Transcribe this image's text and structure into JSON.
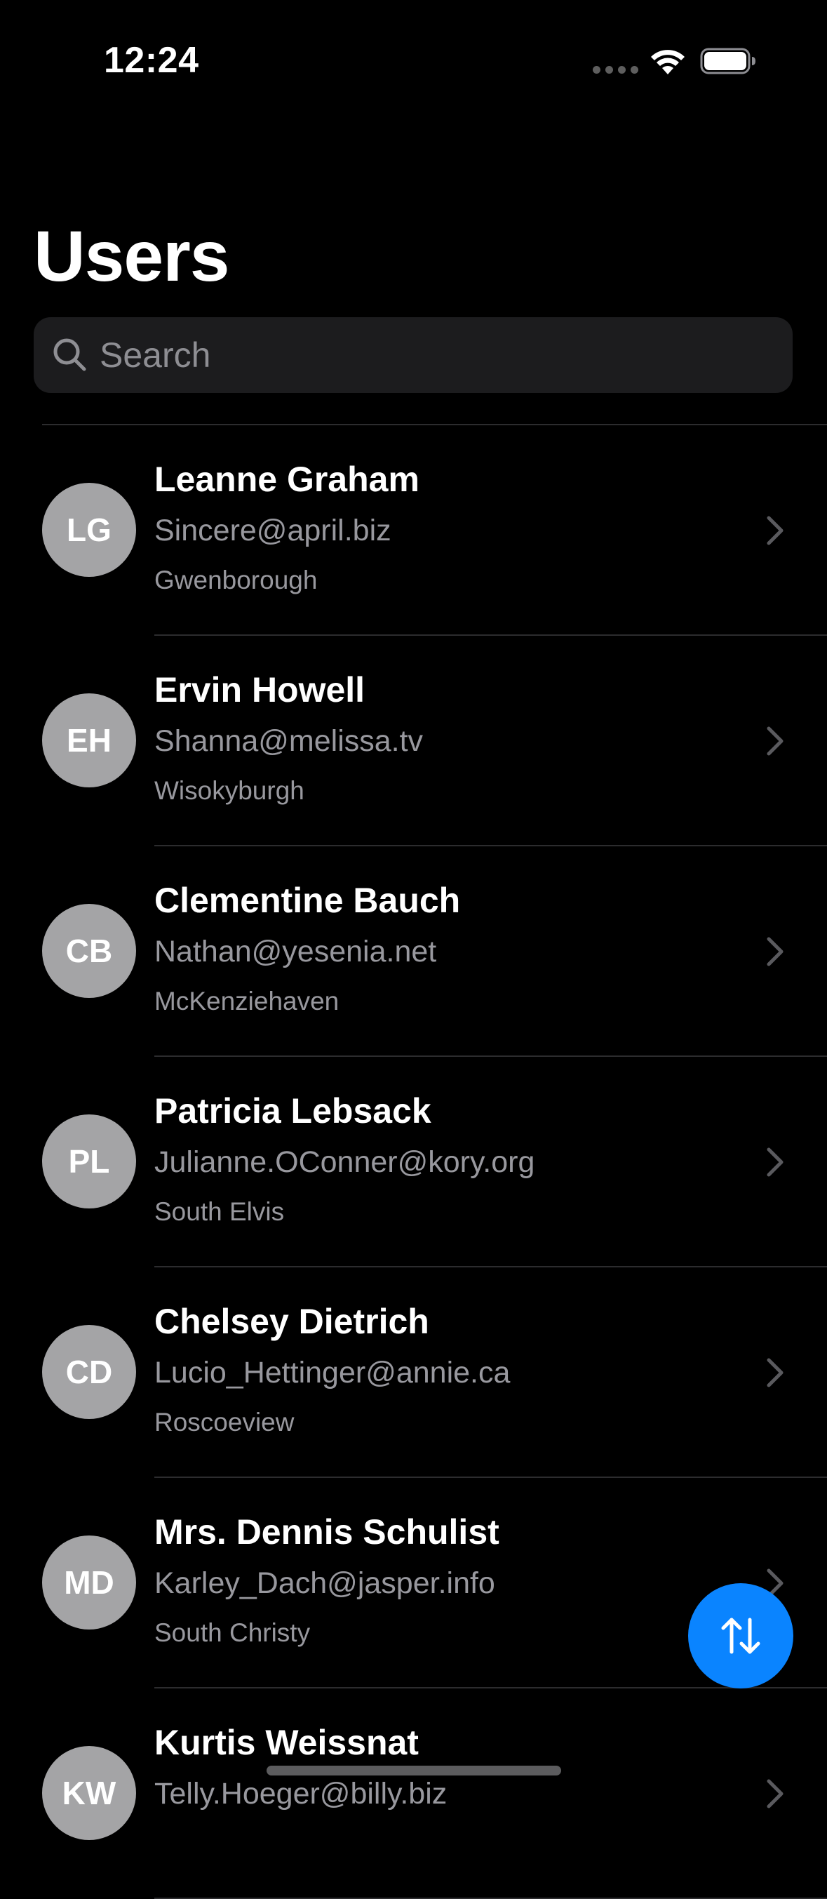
{
  "status_bar": {
    "time": "12:24"
  },
  "page": {
    "title": "Users"
  },
  "search": {
    "placeholder": "Search",
    "value": ""
  },
  "users": [
    {
      "initials": "LG",
      "name": "Leanne Graham",
      "email": "Sincere@april.biz",
      "city": "Gwenborough"
    },
    {
      "initials": "EH",
      "name": "Ervin Howell",
      "email": "Shanna@melissa.tv",
      "city": "Wisokyburgh"
    },
    {
      "initials": "CB",
      "name": "Clementine Bauch",
      "email": "Nathan@yesenia.net",
      "city": "McKenziehaven"
    },
    {
      "initials": "PL",
      "name": "Patricia Lebsack",
      "email": "Julianne.OConner@kory.org",
      "city": "South Elvis"
    },
    {
      "initials": "CD",
      "name": "Chelsey Dietrich",
      "email": "Lucio_Hettinger@annie.ca",
      "city": "Roscoeview"
    },
    {
      "initials": "MD",
      "name": "Mrs. Dennis Schulist",
      "email": "Karley_Dach@jasper.info",
      "city": "South Christy"
    },
    {
      "initials": "KW",
      "name": "Kurtis Weissnat",
      "email": "Telly.Hoeger@billy.biz",
      "city": ""
    }
  ],
  "colors": {
    "background": "#000000",
    "accent": "#0a84ff",
    "avatar": "#a4a4a6",
    "secondary_text": "#98989e"
  },
  "icons": {
    "search": "magnifying-glass-icon",
    "chevron": "chevron-right-icon",
    "fab": "sort-arrows-icon"
  }
}
